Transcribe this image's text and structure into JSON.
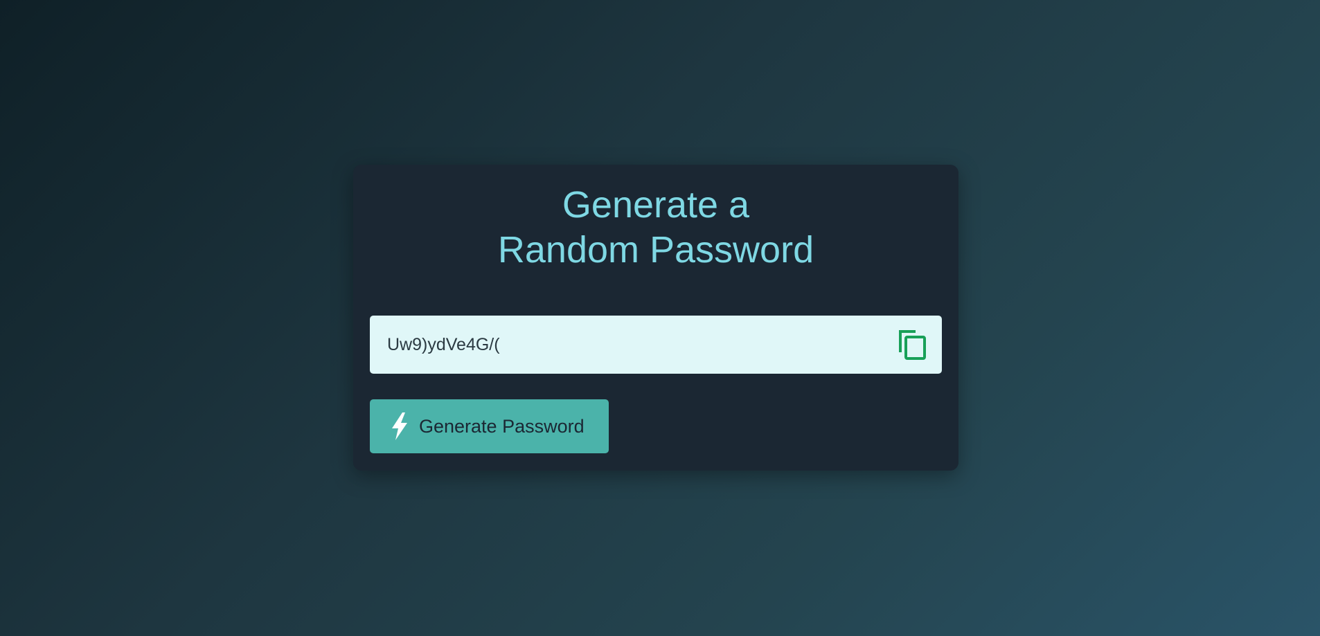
{
  "card": {
    "title_line1": "Generate a",
    "title_line2": "Random Password"
  },
  "password_field": {
    "value": "Uw9)ydVe4G/(",
    "copy_icon": "copy-icon"
  },
  "generate_button": {
    "label": "Generate Password",
    "icon": "bolt-icon"
  },
  "colors": {
    "title": "#7fd8e4",
    "card_bg": "#1b2733",
    "field_bg": "#e0f7f8",
    "button_bg": "#4bb3aa",
    "copy_icon": "#18a058"
  }
}
